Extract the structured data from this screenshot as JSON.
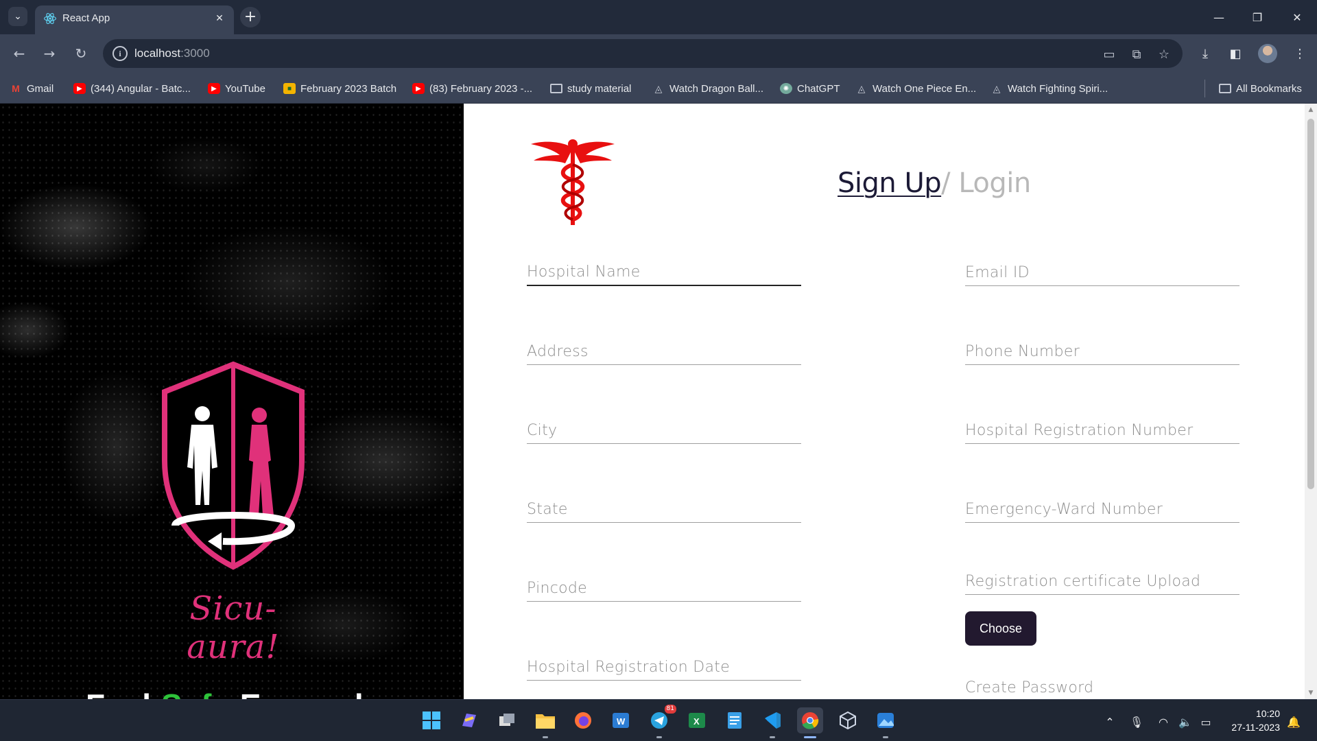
{
  "browser": {
    "tab_title": "React App",
    "url_host": "localhost",
    "url_port": ":3000",
    "bookmarks": [
      {
        "label": "Gmail",
        "icon": "gmail-icon"
      },
      {
        "label": "(344) Angular - Batc...",
        "icon": "youtube-icon"
      },
      {
        "label": "YouTube",
        "icon": "youtube-icon"
      },
      {
        "label": "February 2023 Batch",
        "icon": "classroom-icon"
      },
      {
        "label": "(83) February 2023 -...",
        "icon": "youtube-icon"
      },
      {
        "label": "study material",
        "icon": "folder-icon"
      },
      {
        "label": "Watch Dragon Ball...",
        "icon": "site-icon"
      },
      {
        "label": "ChatGPT",
        "icon": "chatgpt-icon"
      },
      {
        "label": "Watch One Piece En...",
        "icon": "site-icon"
      },
      {
        "label": "Watch Fighting Spiri...",
        "icon": "site-icon"
      }
    ],
    "all_bookmarks": "All Bookmarks"
  },
  "brand": {
    "name": "Sicu-aura!",
    "tagline_part1": "Feel ",
    "tagline_part2": "Safe",
    "tagline_part3": " Everywhere",
    "accent_color": "#e0317a",
    "tagline_accent": "#2ec23a"
  },
  "auth": {
    "signup_label": "Sign Up",
    "slash": "/",
    "login_label": " Login"
  },
  "form": {
    "left_fields": [
      "Hospital Name",
      "Address",
      "City",
      "State",
      "Pincode",
      "Hospital Registration Date"
    ],
    "right_fields": [
      "Email ID",
      "Phone Number",
      "Hospital Registration Number",
      "Emergency-Ward Number",
      "Registration certificate Upload",
      "Create Password"
    ],
    "choose_button": "Choose"
  },
  "taskbar": {
    "time": "10:20",
    "date": "27-11-2023",
    "telegram_badge": "81"
  }
}
